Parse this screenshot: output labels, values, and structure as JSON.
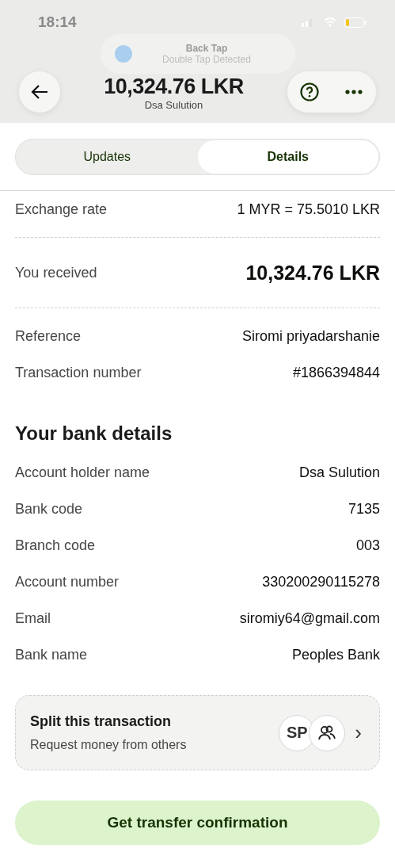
{
  "status_bar": {
    "time": "18:14"
  },
  "notification": {
    "title": "Back Tap",
    "subtitle": "Double Tap Detected"
  },
  "header": {
    "amount": "10,324.76 LKR",
    "name": "Dsa Sulution"
  },
  "tabs": [
    {
      "label": "Updates",
      "selected": false
    },
    {
      "label": "Details",
      "selected": true
    }
  ],
  "transfer_rows": [
    {
      "kind": "plain",
      "label": "Exchange rate",
      "value": "1 MYR = 75.5010 LKR",
      "divider_after": true
    },
    {
      "kind": "large",
      "label": "You received",
      "value": "10,324.76 LKR",
      "divider_after": true
    },
    {
      "kind": "plain",
      "label": "Reference",
      "value": "Siromi priyadarshanie",
      "divider_after": false
    },
    {
      "kind": "plain",
      "label": "Transaction number",
      "value": "#1866394844",
      "divider_after": false
    }
  ],
  "bank_details": {
    "heading": "Your bank details",
    "rows": [
      {
        "label": "Account holder name",
        "value": "Dsa Sulution"
      },
      {
        "label": "Bank code",
        "value": "7135"
      },
      {
        "label": "Branch code",
        "value": "003"
      },
      {
        "label": "Account number",
        "value": "330200290115278"
      },
      {
        "label": "Email",
        "value": "siromiy64@gmail.com"
      },
      {
        "label": "Bank name",
        "value": "Peoples Bank"
      }
    ]
  },
  "split": {
    "title": "Split this transaction",
    "subtitle": "Request money from others",
    "initials": "SP",
    "chevron": "›"
  },
  "primary_button": "Get transfer confirmation"
}
